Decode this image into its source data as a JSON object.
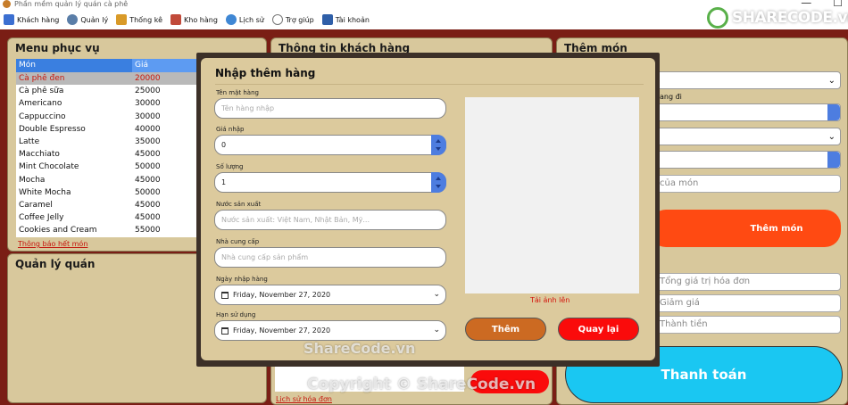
{
  "app": {
    "title": "Phần mềm quản lý quán cà phê"
  },
  "menubar": [
    {
      "label": "Khách hàng",
      "icon": "customer-icon",
      "color": "#3b6fd1"
    },
    {
      "label": "Quản lý",
      "icon": "gear-icon",
      "color": "#5a7ea8"
    },
    {
      "label": "Thống kê",
      "icon": "chart-icon",
      "color": "#d99a28"
    },
    {
      "label": "Kho hàng",
      "icon": "warehouse-icon",
      "color": "#c14a3a"
    },
    {
      "label": "Lịch sử",
      "icon": "history-icon",
      "color": "#3f87d4"
    },
    {
      "label": "Trợ giúp",
      "icon": "help-icon",
      "color": "#777777"
    },
    {
      "label": "Tài khoản",
      "icon": "account-icon",
      "color": "#2f5fa8"
    }
  ],
  "menu_panel": {
    "title": "Menu phục vụ",
    "columns": [
      "Món",
      "Giá"
    ],
    "rows": [
      [
        "Cà phê đen",
        "20000"
      ],
      [
        "Cà phê sữa",
        "25000"
      ],
      [
        "Americano",
        "30000"
      ],
      [
        "Cappuccino",
        "30000"
      ],
      [
        "Double Espresso",
        "40000"
      ],
      [
        "Latte",
        "35000"
      ],
      [
        "Macchiato",
        "45000"
      ],
      [
        "Mint Chocolate",
        "50000"
      ],
      [
        "Mocha",
        "45000"
      ],
      [
        "White Mocha",
        "50000"
      ],
      [
        "Caramel",
        "45000"
      ],
      [
        "Coffee Jelly",
        "45000"
      ],
      [
        "Cookies and Cream",
        "55000"
      ]
    ],
    "out_link": "Thông báo hết món"
  },
  "manage_panel": {
    "title": "Quản lý quán"
  },
  "customer_panel": {
    "title": "Thông tin khách hàng",
    "history_link": "Lịch sử hóa đơn"
  },
  "add_panel": {
    "title": "Thêm món",
    "partial_label": "ang đi",
    "note_placeholder_visible": "của món",
    "add_button": "Thêm món",
    "total_placeholder": "Tổng giá trị hóa đơn",
    "discount_placeholder": "Giảm giá",
    "final_placeholder": "Thành tiền",
    "pay_button": "Thanh toán"
  },
  "dialog": {
    "title": "Nhập thêm hàng",
    "name_label": "Tên mặt hàng",
    "name_placeholder": "Tên hàng nhập",
    "price_label": "Giá nhập",
    "price_value": "0",
    "qty_label": "Số lượng",
    "qty_value": "1",
    "country_label": "Nước sản xuất",
    "country_placeholder": "Nước sản xuất: Việt Nam, Nhật Bản, Mỹ...",
    "supplier_label": "Nhà cung cấp",
    "supplier_placeholder": "Nhà cung cấp sản phẩm",
    "import_date_label": "Ngày nhập hàng",
    "import_date_value": "Friday, November 27, 2020",
    "expiry_label": "Hạn sử dụng",
    "expiry_value": "Friday, November 27, 2020",
    "upload_label": "Tải ảnh lên",
    "add_button": "Thêm",
    "back_button": "Quay lại"
  },
  "watermark": {
    "logo": "SHARECODE.vn",
    "center": "ShareCode.vn",
    "bottom": "Copyright © ShareCode.vn"
  },
  "colors": {
    "panel": "#d8c89c",
    "bg": "#7a1e15",
    "orange": "#ff4a12",
    "red": "#fa0b0b",
    "brown": "#cc6a22",
    "cyan": "#1ac7f2"
  }
}
